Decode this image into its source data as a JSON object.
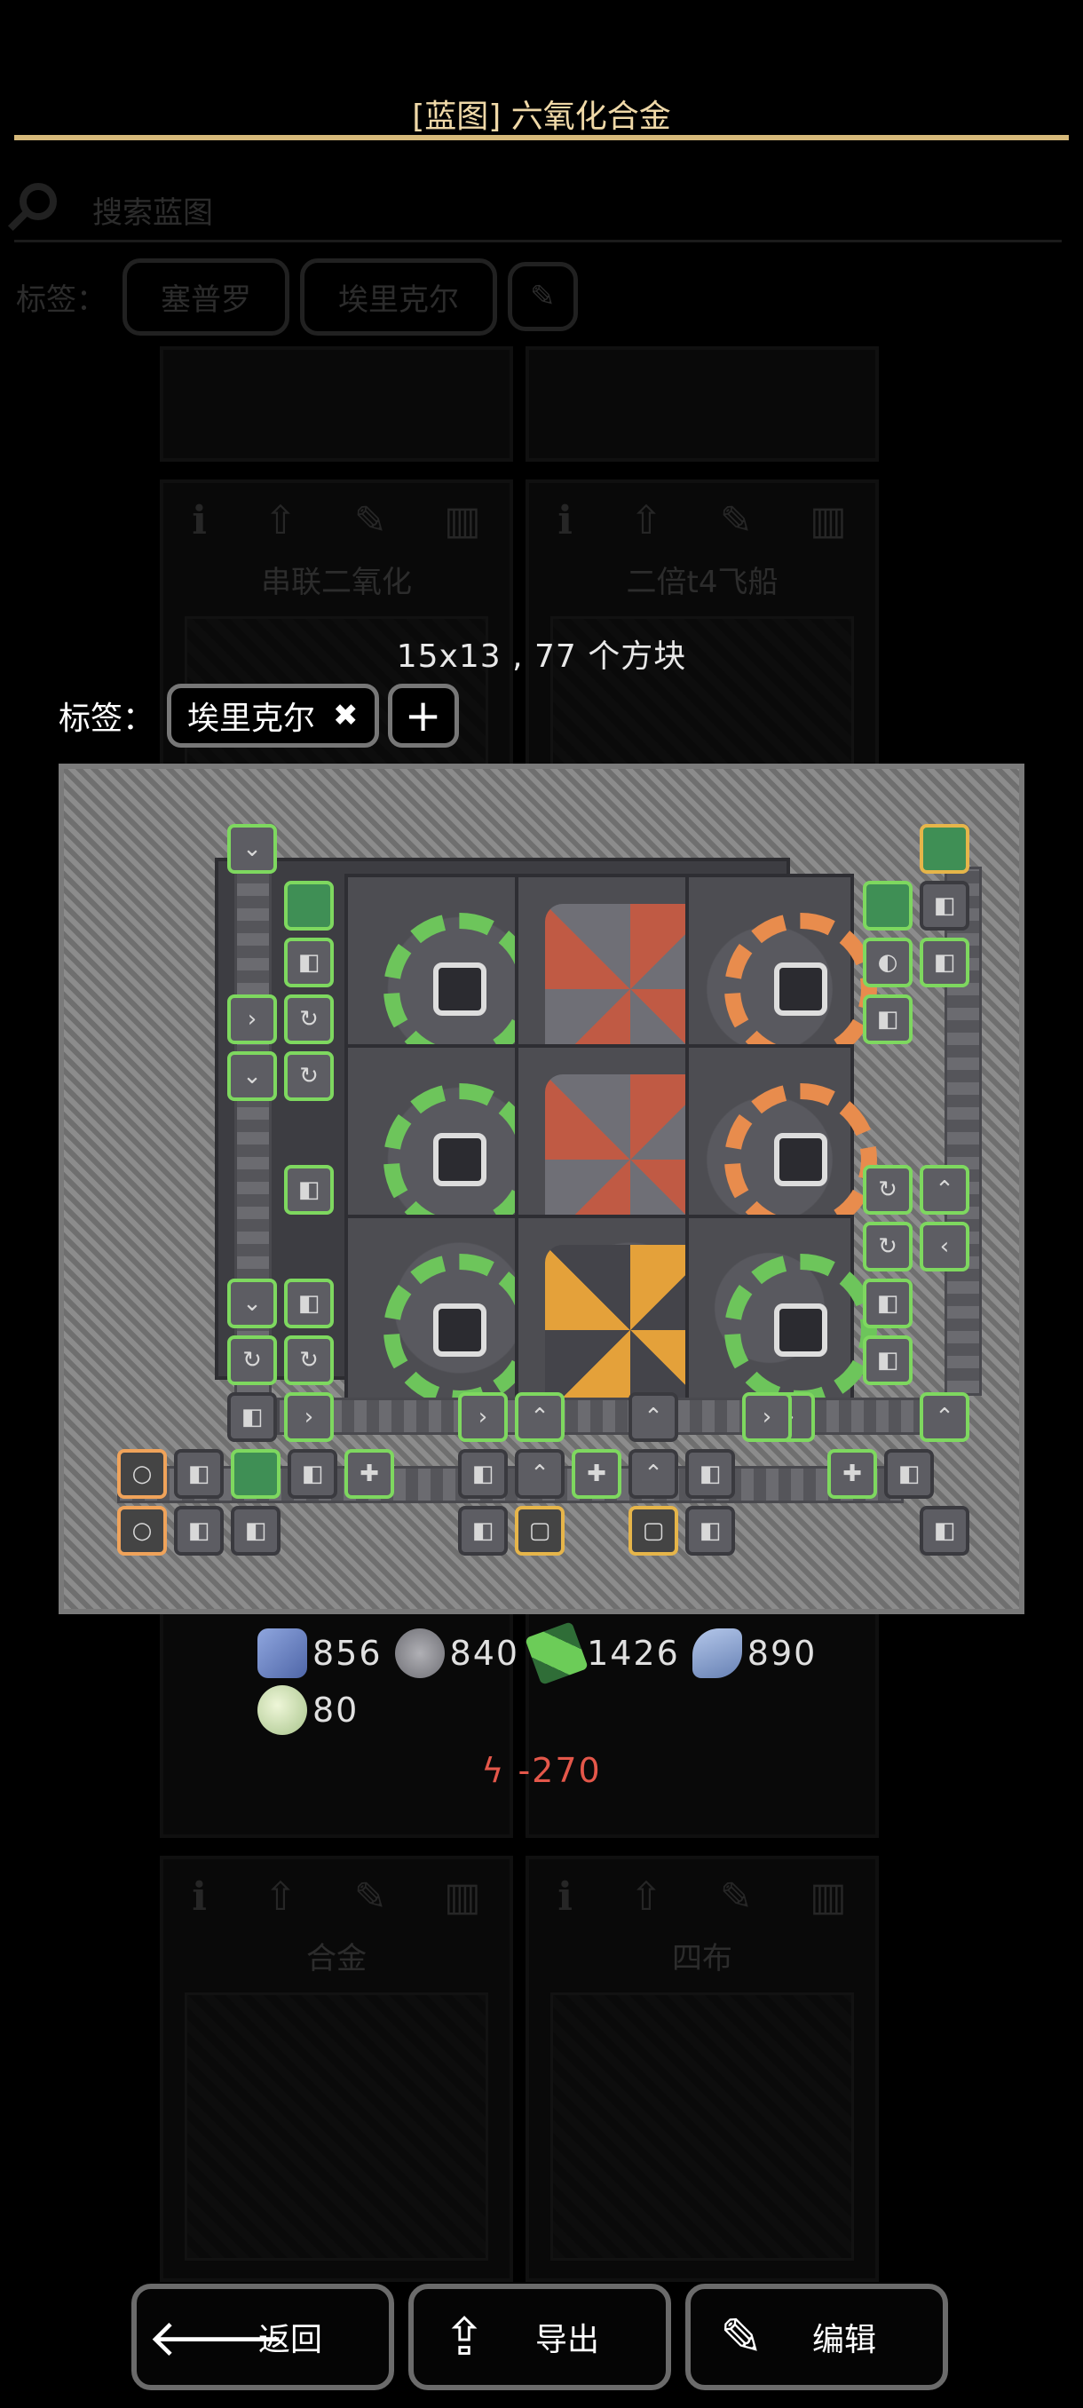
{
  "background": {
    "search_placeholder": "搜索蓝图",
    "tags_label": "标签：",
    "tags": [
      "塞普罗",
      "埃里克尔"
    ],
    "cards": [
      {
        "name": ""
      },
      {
        "name": ""
      },
      {
        "name": "串联二氧化"
      },
      {
        "name": "二倍t4飞船"
      },
      {
        "name": ""
      },
      {
        "name": ""
      },
      {
        "name": "合金"
      },
      {
        "name": "四布"
      }
    ]
  },
  "dialog": {
    "title": "[蓝图] 六氧化合金",
    "dimensions": "15x13 , 77 个方块",
    "tags_label": "标签：",
    "tags": [
      {
        "label": "埃里克尔"
      }
    ],
    "add_tag": "+",
    "remove_tag": "✖"
  },
  "requirements": {
    "items": [
      {
        "icon": "titanium-icon",
        "amount": "856",
        "color": "#7d95d6"
      },
      {
        "icon": "lead-icon",
        "amount": "840",
        "color": "#9a9aa0"
      },
      {
        "icon": "plastanium-icon",
        "amount": "1426",
        "color": "#6ccc58"
      },
      {
        "icon": "silicon-icon",
        "amount": "890",
        "color": "#8ea4d8"
      },
      {
        "icon": "spore-pod-icon",
        "amount": "80",
        "color": "#d6e8b8"
      }
    ],
    "power": "ϟ -270",
    "power_color": "#e4574a"
  },
  "buttons": {
    "back": "返回",
    "export": "导出",
    "edit": "编辑"
  },
  "colors": {
    "title": "#f0d9a8",
    "accent_rule": "#d6b97a",
    "chip_border": "#777777"
  }
}
